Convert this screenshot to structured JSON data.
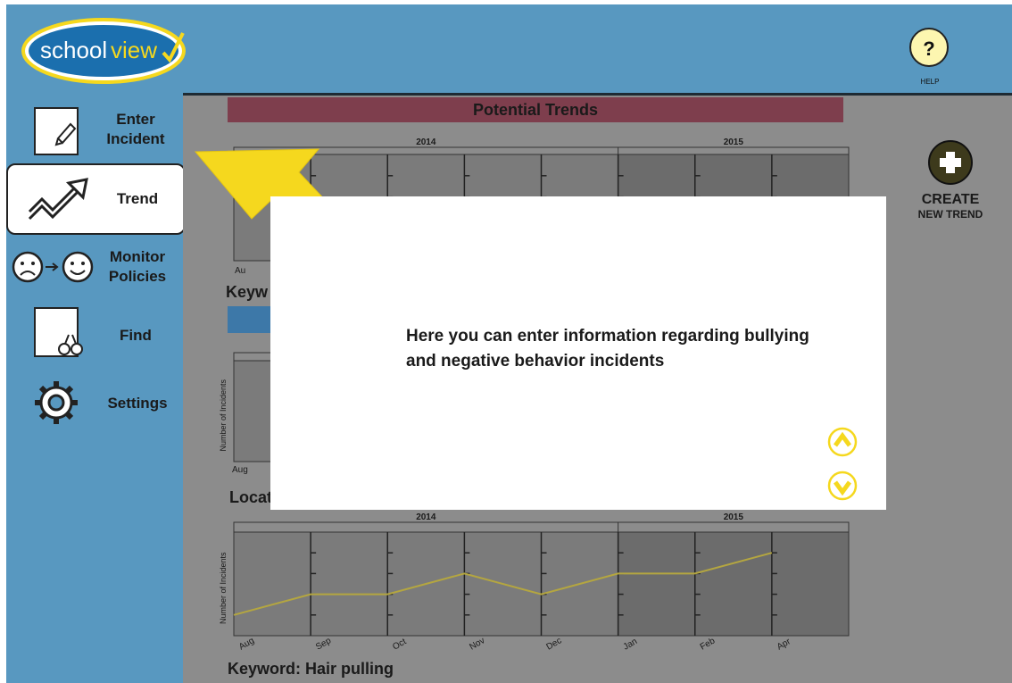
{
  "app": {
    "logo_text_school": "school",
    "logo_text_view": "view"
  },
  "help": {
    "symbol": "?",
    "label": "HELP"
  },
  "nav": {
    "items": [
      {
        "label_line1": "Enter",
        "label_line2": "Incident",
        "icon": "note-pencil-icon"
      },
      {
        "label_line1": "Trend",
        "label_line2": "",
        "icon": "trend-arrow-icon"
      },
      {
        "label_line1": "Monitor",
        "label_line2": "Policies",
        "icon": "sad-to-happy-icon"
      },
      {
        "label_line1": "Find",
        "label_line2": "",
        "icon": "binoculars-icon"
      },
      {
        "label_line1": "Settings",
        "label_line2": "",
        "icon": "gear-icon"
      }
    ]
  },
  "trends": {
    "header": "Potential Trends",
    "year_2014": "2014",
    "year_2015": "2015",
    "keyword_partial_1": "Keyw",
    "location_partial": "Locat",
    "keyword_full": "Keyword: Hair pulling",
    "y_axis_label": "Number of Incidents",
    "month_partial_1": "Au",
    "month_partial_2": "Aug"
  },
  "chart_data": {
    "type": "line",
    "x": [
      "Aug",
      "Sep",
      "Oct",
      "Nov",
      "Dec",
      "Jan",
      "Feb",
      "Apr"
    ],
    "series": [
      {
        "values": [
          1,
          2,
          2,
          3,
          2,
          3,
          3,
          4
        ]
      }
    ],
    "ylabel": "Number of Incidents",
    "year_spans": [
      {
        "label": "2014",
        "from": "Aug",
        "to": "Dec"
      },
      {
        "label": "2015",
        "from": "Jan",
        "to": "Apr"
      }
    ]
  },
  "create": {
    "label_line1": "CREATE",
    "label_line2": "NEW TREND"
  },
  "overlay": {
    "text": "Here you can enter information regarding bullying and negative behavior incidents",
    "up_icon": "chevron-up-icon",
    "down_icon": "chevron-down-icon"
  },
  "colors": {
    "background": "#5898c0",
    "content": "#8c8c8c",
    "header": "#7e3e4d",
    "accent_yellow": "#f5d81e",
    "line": "#b4a640"
  }
}
